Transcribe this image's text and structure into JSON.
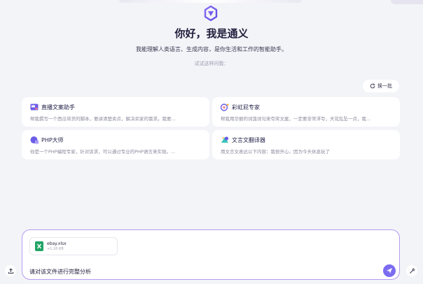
{
  "header": {
    "greeting": "你好，我是通义",
    "subtitle": "我能理解人类语言、生成内容，是你生活和工作的智能助手。",
    "try_hint": "试试这样问我："
  },
  "refresh": {
    "label": "换一批",
    "icon": "refresh-icon"
  },
  "cards": [
    {
      "title": "直播文案助手",
      "desc": "帮我撰写一个西瓜带货的脚本，要讲清楚卖点，解决买家的需求。我要...",
      "icon": "video-icon"
    },
    {
      "title": "彩虹屁专家",
      "desc": "帮我用华丽的词藻词句来夸奖文案，一定要非常浮夸，天花乱坠一点，我...",
      "icon": "star-badge-icon"
    },
    {
      "title": "PHP大师",
      "desc": "你是一个PHP编程专家，针对诉求，可以通过专业的PHP语言来实现。...",
      "icon": "php-icon"
    },
    {
      "title": "文言文翻译器",
      "desc": "用文言文表达以下内容：我很开心，因为今天休息玩了",
      "icon": "translate-icon"
    }
  ],
  "composer": {
    "file": {
      "name": "ebay.xlsx",
      "size": "+1.16 KB",
      "icon": "excel-file-icon"
    },
    "prompt": "请对该文件进行完整分析",
    "send_icon": "send-icon"
  },
  "colors": {
    "accent": "#7c6cf0",
    "border": "#b69cf2",
    "background": "#f3f4f8"
  }
}
